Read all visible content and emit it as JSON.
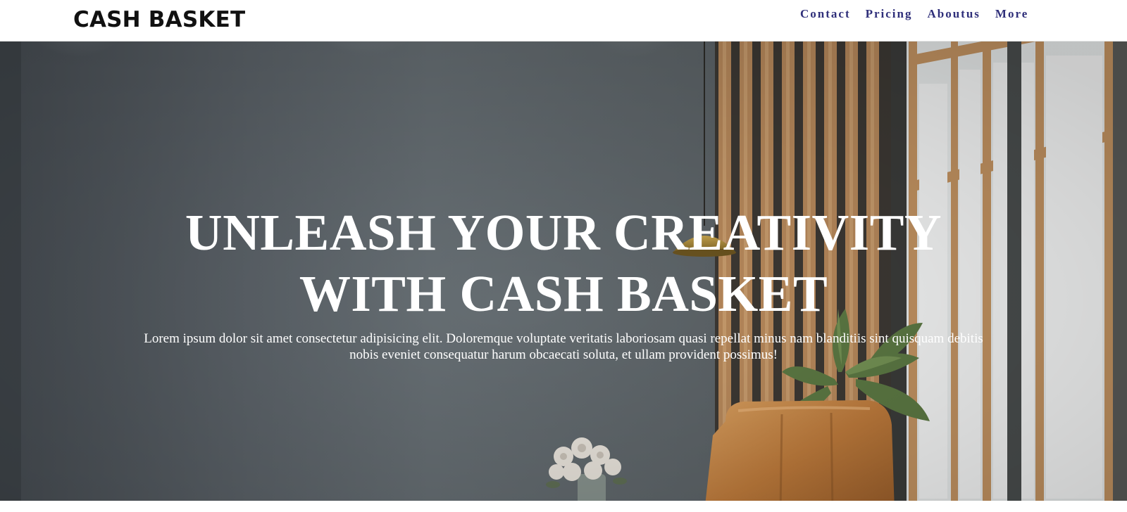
{
  "brand": {
    "name": "CASH BASKET"
  },
  "nav": {
    "items": [
      {
        "label": "Contact"
      },
      {
        "label": "Pricing"
      },
      {
        "label": "Aboutus"
      },
      {
        "label": "More"
      }
    ]
  },
  "hero": {
    "heading_line1": "UNLEASH YOUR CREATIVITY",
    "heading_line2": "WITH CASH BASKET",
    "description": "Lorem ipsum dolor sit amet consectetur adipisicing elit. Doloremque voluptate veritatis laboriosam quasi repellat minus nam blanditiis sint quisquam debitis nobis eveniet consequatur harum obcaecati soluta, et ullam provident possimus!",
    "background_image": "interior-room-photo"
  },
  "colors": {
    "nav_link": "#2f2f7a",
    "logo": "#111111",
    "hero_text": "#ffffff",
    "wall": "#5a6167",
    "chair": "#c98a45"
  }
}
